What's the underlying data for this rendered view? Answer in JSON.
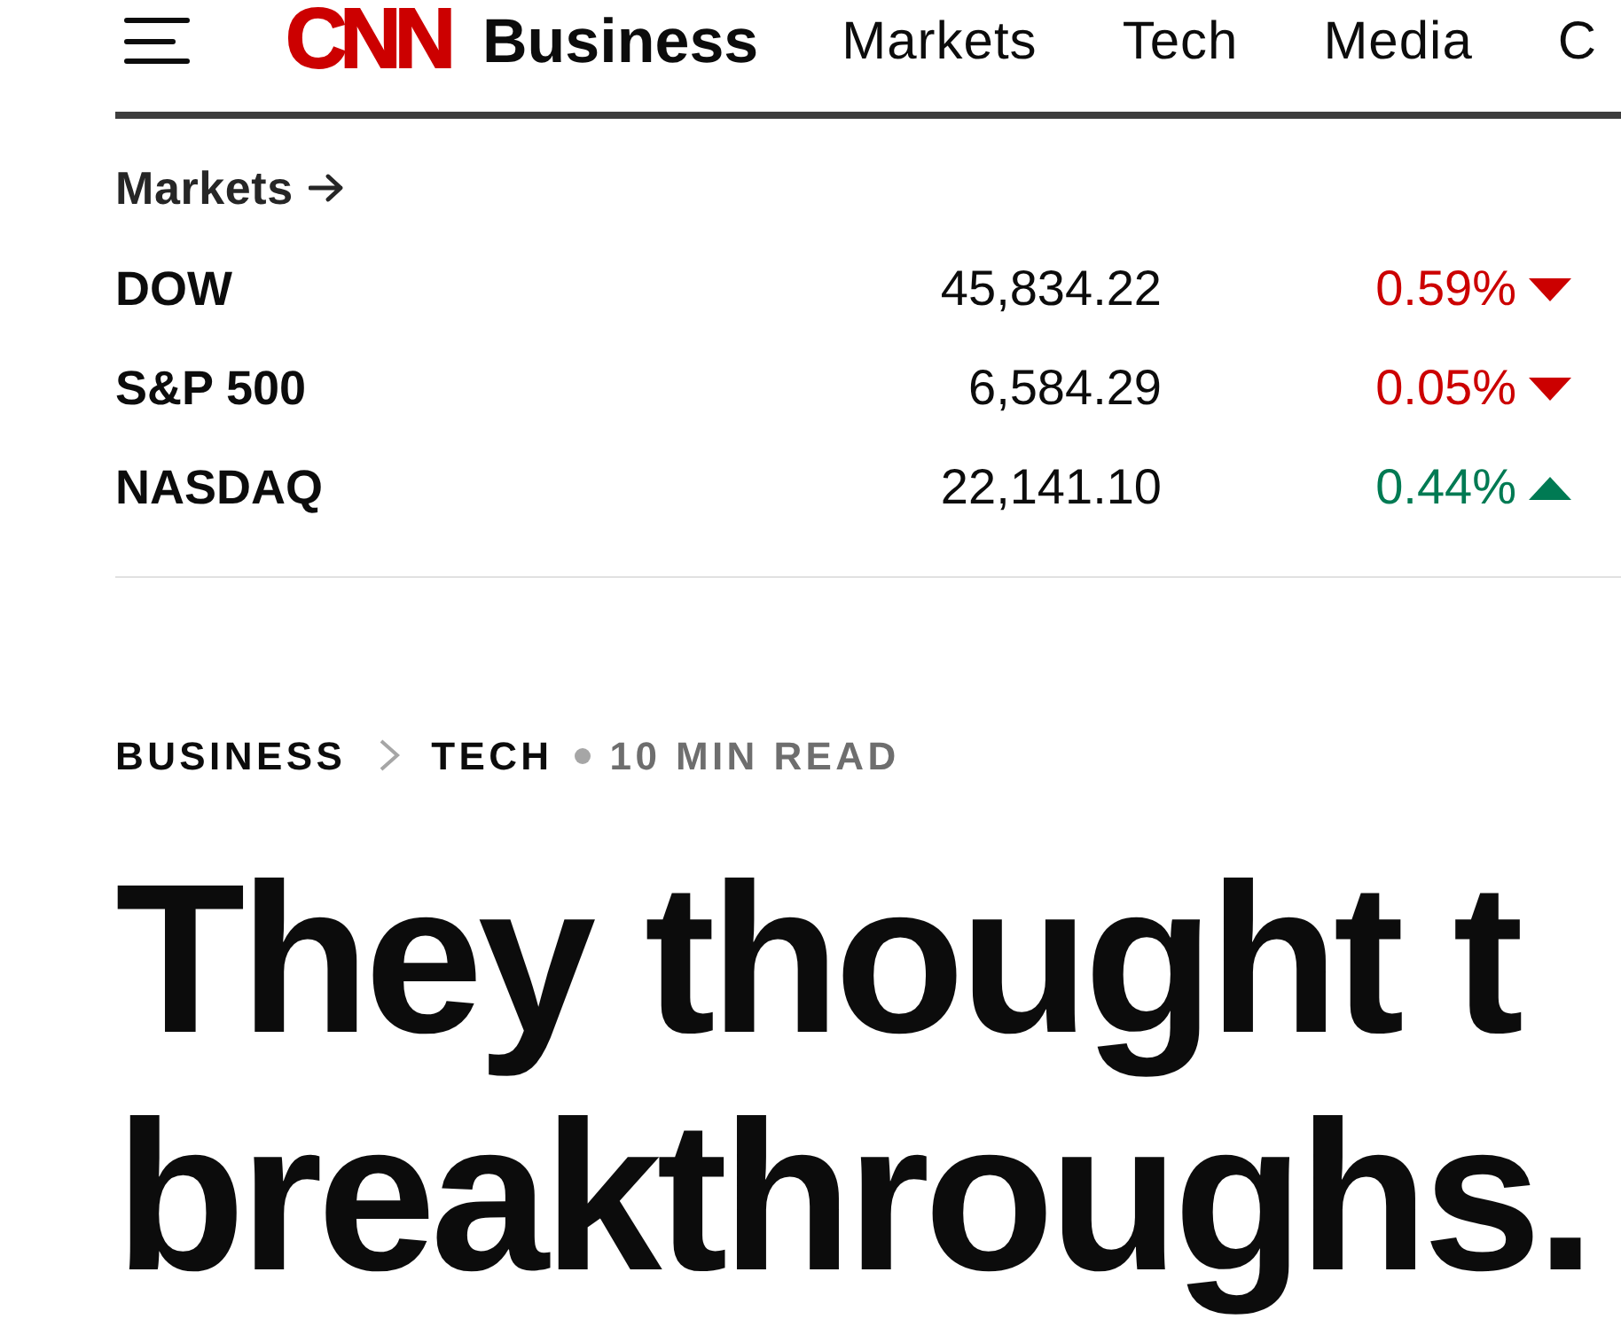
{
  "header": {
    "logo": "CNN",
    "section": "Business",
    "nav": [
      {
        "label": "Markets"
      },
      {
        "label": "Tech"
      },
      {
        "label": "Media"
      },
      {
        "label": "C"
      }
    ]
  },
  "markets": {
    "title": "Markets",
    "rows": [
      {
        "name": "DOW",
        "value": "45,834.22",
        "change": "0.59%",
        "kind": "down"
      },
      {
        "name": "S&P 500",
        "value": "6,584.29",
        "change": "0.05%",
        "kind": "down"
      },
      {
        "name": "NASDAQ",
        "value": "22,141.10",
        "change": "0.44%",
        "kind": "up"
      }
    ]
  },
  "breadcrumb": {
    "items": [
      "BUSINESS",
      "TECH"
    ],
    "read_time": "10 MIN READ"
  },
  "headline": {
    "lines": [
      "They thought t",
      "breakthroughs."
    ]
  }
}
